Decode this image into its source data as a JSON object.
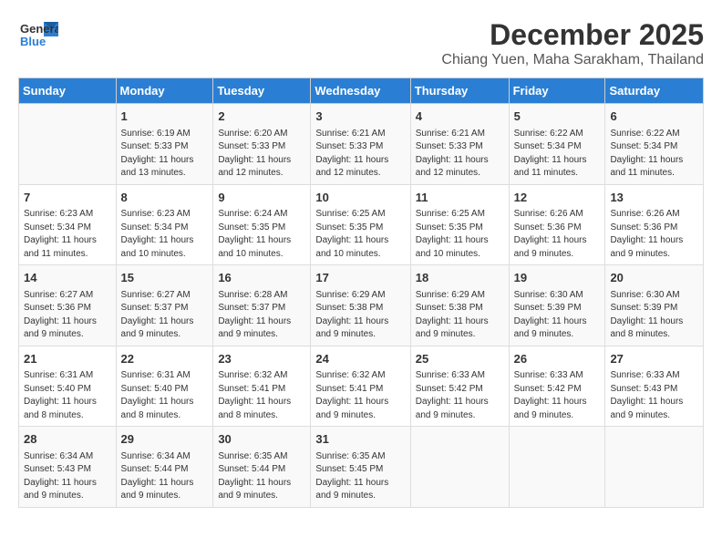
{
  "header": {
    "logo_general": "General",
    "logo_blue": "Blue",
    "month": "December 2025",
    "location": "Chiang Yuen, Maha Sarakham, Thailand"
  },
  "days_of_week": [
    "Sunday",
    "Monday",
    "Tuesday",
    "Wednesday",
    "Thursday",
    "Friday",
    "Saturday"
  ],
  "weeks": [
    [
      {
        "day": "",
        "info": ""
      },
      {
        "day": "1",
        "info": "Sunrise: 6:19 AM\nSunset: 5:33 PM\nDaylight: 11 hours\nand 13 minutes."
      },
      {
        "day": "2",
        "info": "Sunrise: 6:20 AM\nSunset: 5:33 PM\nDaylight: 11 hours\nand 12 minutes."
      },
      {
        "day": "3",
        "info": "Sunrise: 6:21 AM\nSunset: 5:33 PM\nDaylight: 11 hours\nand 12 minutes."
      },
      {
        "day": "4",
        "info": "Sunrise: 6:21 AM\nSunset: 5:33 PM\nDaylight: 11 hours\nand 12 minutes."
      },
      {
        "day": "5",
        "info": "Sunrise: 6:22 AM\nSunset: 5:34 PM\nDaylight: 11 hours\nand 11 minutes."
      },
      {
        "day": "6",
        "info": "Sunrise: 6:22 AM\nSunset: 5:34 PM\nDaylight: 11 hours\nand 11 minutes."
      }
    ],
    [
      {
        "day": "7",
        "info": "Sunrise: 6:23 AM\nSunset: 5:34 PM\nDaylight: 11 hours\nand 11 minutes."
      },
      {
        "day": "8",
        "info": "Sunrise: 6:23 AM\nSunset: 5:34 PM\nDaylight: 11 hours\nand 10 minutes."
      },
      {
        "day": "9",
        "info": "Sunrise: 6:24 AM\nSunset: 5:35 PM\nDaylight: 11 hours\nand 10 minutes."
      },
      {
        "day": "10",
        "info": "Sunrise: 6:25 AM\nSunset: 5:35 PM\nDaylight: 11 hours\nand 10 minutes."
      },
      {
        "day": "11",
        "info": "Sunrise: 6:25 AM\nSunset: 5:35 PM\nDaylight: 11 hours\nand 10 minutes."
      },
      {
        "day": "12",
        "info": "Sunrise: 6:26 AM\nSunset: 5:36 PM\nDaylight: 11 hours\nand 9 minutes."
      },
      {
        "day": "13",
        "info": "Sunrise: 6:26 AM\nSunset: 5:36 PM\nDaylight: 11 hours\nand 9 minutes."
      }
    ],
    [
      {
        "day": "14",
        "info": "Sunrise: 6:27 AM\nSunset: 5:36 PM\nDaylight: 11 hours\nand 9 minutes."
      },
      {
        "day": "15",
        "info": "Sunrise: 6:27 AM\nSunset: 5:37 PM\nDaylight: 11 hours\nand 9 minutes."
      },
      {
        "day": "16",
        "info": "Sunrise: 6:28 AM\nSunset: 5:37 PM\nDaylight: 11 hours\nand 9 minutes."
      },
      {
        "day": "17",
        "info": "Sunrise: 6:29 AM\nSunset: 5:38 PM\nDaylight: 11 hours\nand 9 minutes."
      },
      {
        "day": "18",
        "info": "Sunrise: 6:29 AM\nSunset: 5:38 PM\nDaylight: 11 hours\nand 9 minutes."
      },
      {
        "day": "19",
        "info": "Sunrise: 6:30 AM\nSunset: 5:39 PM\nDaylight: 11 hours\nand 9 minutes."
      },
      {
        "day": "20",
        "info": "Sunrise: 6:30 AM\nSunset: 5:39 PM\nDaylight: 11 hours\nand 8 minutes."
      }
    ],
    [
      {
        "day": "21",
        "info": "Sunrise: 6:31 AM\nSunset: 5:40 PM\nDaylight: 11 hours\nand 8 minutes."
      },
      {
        "day": "22",
        "info": "Sunrise: 6:31 AM\nSunset: 5:40 PM\nDaylight: 11 hours\nand 8 minutes."
      },
      {
        "day": "23",
        "info": "Sunrise: 6:32 AM\nSunset: 5:41 PM\nDaylight: 11 hours\nand 8 minutes."
      },
      {
        "day": "24",
        "info": "Sunrise: 6:32 AM\nSunset: 5:41 PM\nDaylight: 11 hours\nand 9 minutes."
      },
      {
        "day": "25",
        "info": "Sunrise: 6:33 AM\nSunset: 5:42 PM\nDaylight: 11 hours\nand 9 minutes."
      },
      {
        "day": "26",
        "info": "Sunrise: 6:33 AM\nSunset: 5:42 PM\nDaylight: 11 hours\nand 9 minutes."
      },
      {
        "day": "27",
        "info": "Sunrise: 6:33 AM\nSunset: 5:43 PM\nDaylight: 11 hours\nand 9 minutes."
      }
    ],
    [
      {
        "day": "28",
        "info": "Sunrise: 6:34 AM\nSunset: 5:43 PM\nDaylight: 11 hours\nand 9 minutes."
      },
      {
        "day": "29",
        "info": "Sunrise: 6:34 AM\nSunset: 5:44 PM\nDaylight: 11 hours\nand 9 minutes."
      },
      {
        "day": "30",
        "info": "Sunrise: 6:35 AM\nSunset: 5:44 PM\nDaylight: 11 hours\nand 9 minutes."
      },
      {
        "day": "31",
        "info": "Sunrise: 6:35 AM\nSunset: 5:45 PM\nDaylight: 11 hours\nand 9 minutes."
      },
      {
        "day": "",
        "info": ""
      },
      {
        "day": "",
        "info": ""
      },
      {
        "day": "",
        "info": ""
      }
    ]
  ]
}
